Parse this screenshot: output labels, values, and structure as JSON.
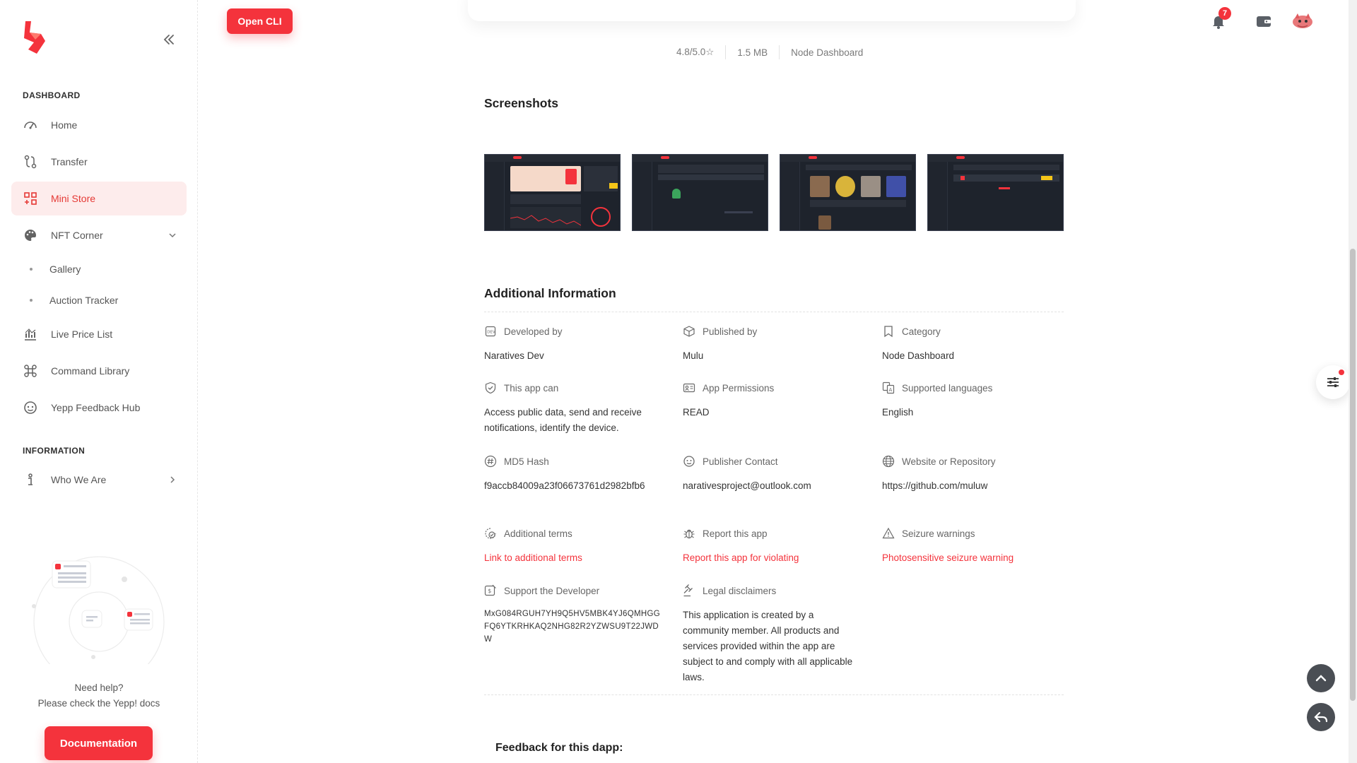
{
  "sidebar": {
    "section_dashboard": "DASHBOARD",
    "section_information": "INFORMATION",
    "items": {
      "home": "Home",
      "transfer": "Transfer",
      "mini_store": "Mini Store",
      "nft_corner": "NFT Corner",
      "gallery": "Gallery",
      "auction_tracker": "Auction Tracker",
      "live_price_list": "Live Price List",
      "command_library": "Command Library",
      "feedback_hub": "Yepp Feedback Hub",
      "who_we_are": "Who We Are"
    },
    "help_line1": "Need help?",
    "help_line2": "Please check the Yepp! docs",
    "documentation_button": "Documentation"
  },
  "header": {
    "open_cli": "Open CLI",
    "notification_count": "7"
  },
  "app_meta": {
    "rating": "4.8/5.0☆",
    "size": "1.5 MB",
    "category": "Node Dashboard"
  },
  "screenshots": {
    "title": "Screenshots",
    "thumbnails": [
      "screenshot-dashboard",
      "screenshot-list",
      "screenshot-gallery",
      "screenshot-table"
    ]
  },
  "additional_info": {
    "title": "Additional Information",
    "developed_by": {
      "label": "Developed by",
      "value": "Naratives Dev"
    },
    "published_by": {
      "label": "Published by",
      "value": "Mulu"
    },
    "category": {
      "label": "Category",
      "value": "Node Dashboard"
    },
    "this_app_can": {
      "label": "This app can",
      "value": "Access public data, send and receive notifications, identify the device."
    },
    "app_permissions": {
      "label": "App Permissions",
      "value": "READ"
    },
    "supported_languages": {
      "label": "Supported languages",
      "value": "English"
    },
    "md5_hash": {
      "label": "MD5 Hash",
      "value": "f9accb84009a23f06673761d2982bfb6"
    },
    "publisher_contact": {
      "label": "Publisher Contact",
      "value": "narativesproject@outlook.com"
    },
    "website": {
      "label": "Website or Repository",
      "value": "https://github.com/muluw"
    },
    "additional_terms": {
      "label": "Additional terms",
      "value": "Link to additional terms"
    },
    "report_app": {
      "label": "Report this app",
      "value": "Report this app for violating"
    },
    "seizure_warnings": {
      "label": "Seizure warnings",
      "value": "Photosensitive seizure warning"
    },
    "support_developer": {
      "label": "Support the Developer",
      "value": "MxG084RGUH7YH9Q5HV5MBK4YJ6QMHGGFQ6YTKRHKAQ2NHG82R2YZWSU9T22JWDW"
    },
    "legal_disclaimers": {
      "label": "Legal disclaimers",
      "value": "This application is created by a community member. All products and services provided within the app are subject to and comply with all applicable laws."
    }
  },
  "feedback": {
    "title": "Feedback for this dapp:"
  },
  "colors": {
    "accent": "#f4333c",
    "active_bg": "#fdecec",
    "text": "#2a2a2a"
  }
}
